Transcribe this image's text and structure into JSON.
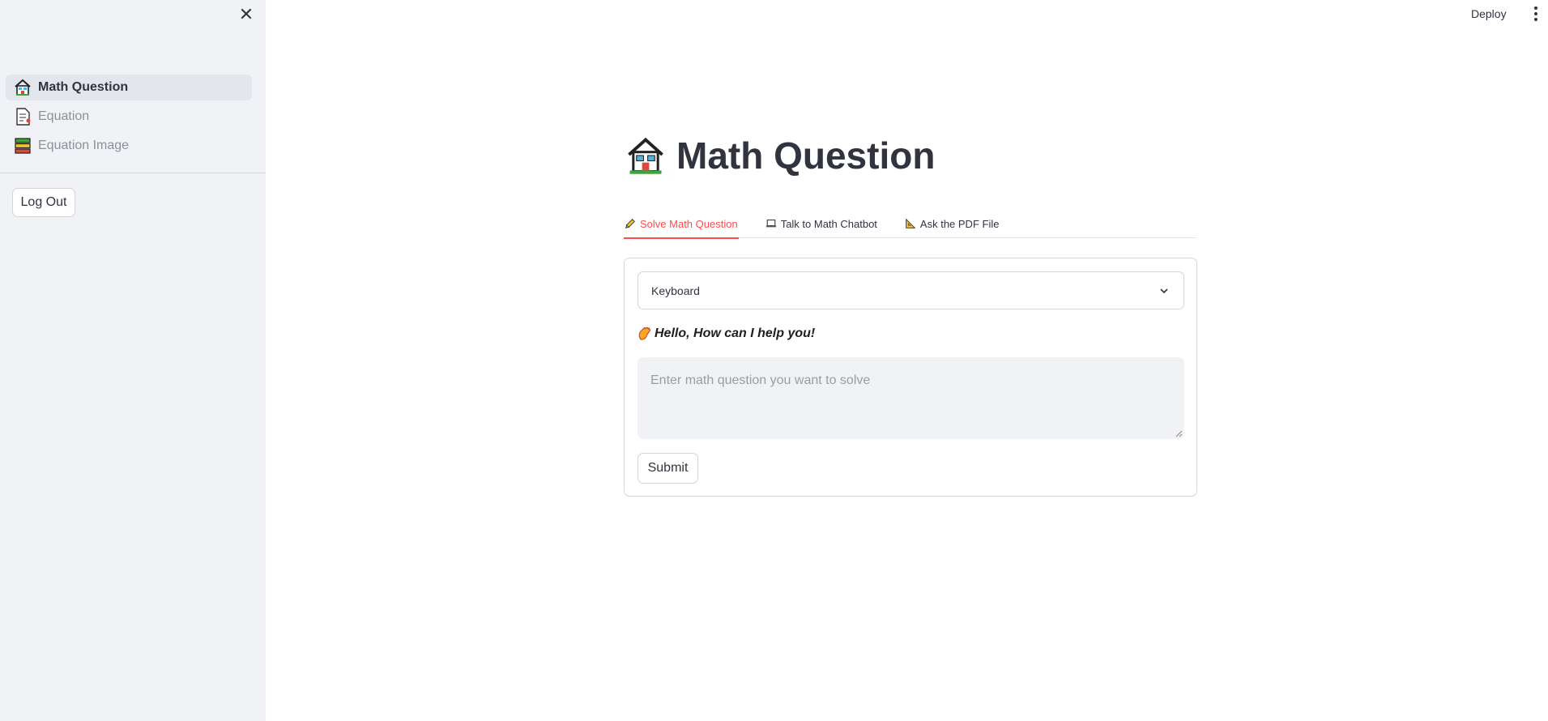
{
  "sidebar": {
    "close_icon": "close-icon",
    "nav_items": [
      {
        "label": "Math Question",
        "icon": "house-icon",
        "active": true
      },
      {
        "label": "Equation",
        "icon": "document-icon",
        "active": false
      },
      {
        "label": "Equation Image",
        "icon": "books-icon",
        "active": false
      }
    ],
    "logout_label": "Log Out"
  },
  "header": {
    "deploy_label": "Deploy",
    "menu_icon": "more-vertical-icon"
  },
  "main": {
    "title": "Math Question",
    "title_icon": "house-icon",
    "tabs": [
      {
        "label": "Solve Math Question",
        "icon": "pencil-icon",
        "active": true
      },
      {
        "label": "Talk to Math Chatbot",
        "icon": "laptop-icon",
        "active": false
      },
      {
        "label": "Ask the PDF File",
        "icon": "triangle-ruler-icon",
        "active": false
      }
    ],
    "input_mode": {
      "value": "Keyboard",
      "icon": "chevron-down-icon"
    },
    "greeting": "Hello, How can I help you!",
    "greeting_icon": "waving-hand-icon",
    "question_input": {
      "value": "",
      "placeholder": "Enter math question you want to solve"
    },
    "submit_label": "Submit"
  },
  "colors": {
    "accent": "#ff4b4b",
    "sidebar_bg": "#f0f2f6",
    "text": "#31333f"
  }
}
